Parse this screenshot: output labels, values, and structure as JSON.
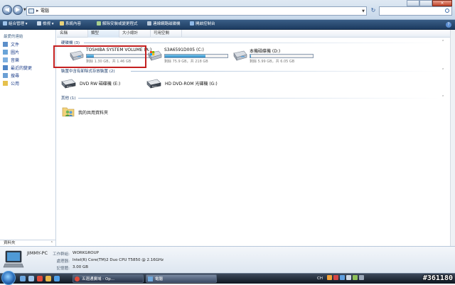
{
  "window": {
    "breadcrumb": "電腦",
    "search_placeholder": ""
  },
  "toolbar": {
    "items": [
      {
        "label": "組合管理",
        "icon": "organize-icon"
      },
      {
        "label": "檢視",
        "icon": "views-icon"
      },
      {
        "label": "系統內容",
        "icon": "system-properties-icon"
      },
      {
        "label": "解除安裝或變更程式",
        "icon": "uninstall-icon"
      },
      {
        "label": "連線網路磁碟機",
        "icon": "map-network-drive-icon"
      },
      {
        "label": "開啟控制台",
        "icon": "control-panel-icon"
      }
    ]
  },
  "sidebar": {
    "heading": "最愛的連結",
    "items": [
      {
        "label": "文件",
        "icon": "documents-icon"
      },
      {
        "label": "圖片",
        "icon": "pictures-icon"
      },
      {
        "label": "音樂",
        "icon": "music-icon"
      },
      {
        "label": "最近的變更",
        "icon": "recent-changes-icon"
      },
      {
        "label": "搜尋",
        "icon": "searches-icon"
      },
      {
        "label": "公用",
        "icon": "public-icon"
      }
    ],
    "folders_label": "資料夾"
  },
  "columns": [
    "名稱",
    "類型",
    "大小總計",
    "可用空間"
  ],
  "groups": {
    "hard_disks": "硬碟機 (3)",
    "removable": "裝置中含有卸除式存放裝置 (2)",
    "other": "其他 (1)"
  },
  "drives": [
    {
      "name": "TOSHIBA SYSTEM VOLUME (A:)",
      "space": "剩餘 1.30 GB，共 1.46 GB",
      "used_fraction": 0.11
    },
    {
      "name": "S3A6591D005 (C:)",
      "space": "剩餘 75.9 GB，共 218 GB",
      "used_fraction": 0.65
    },
    {
      "name": "本機磁碟機 (D:)",
      "space": "剩餘 5.99 GB，共 6.05 GB",
      "used_fraction": 0.01
    }
  ],
  "optical": [
    {
      "name": "DVD RW 磁碟機 (E:)"
    },
    {
      "name": "HD DVD-ROM 光碟機 (G:)"
    }
  ],
  "other_items": [
    {
      "name": "我的共用資料夾"
    }
  ],
  "details": {
    "pc_name": "JIMMY-PC",
    "rows": [
      {
        "label": "工作群組:",
        "value": "WORKGROUP"
      },
      {
        "label": "處理器:",
        "value": "Intel(R) Core(TM)2 Duo CPU      T5850  @ 2.16GHz"
      },
      {
        "label": "記憶體:",
        "value": "3.00 GB"
      }
    ]
  },
  "taskbar": {
    "tasks": [
      {
        "label": "五週通廣域 - Op...",
        "active": false
      },
      {
        "label": "電腦",
        "active": true
      }
    ],
    "tray_lang": "CH",
    "watermark": "#361180"
  },
  "colors": {
    "toolbar": "#1c3b60",
    "link": "#1e3f8a",
    "bar_fill": "#2a8cc8",
    "highlight": "#c42020"
  }
}
